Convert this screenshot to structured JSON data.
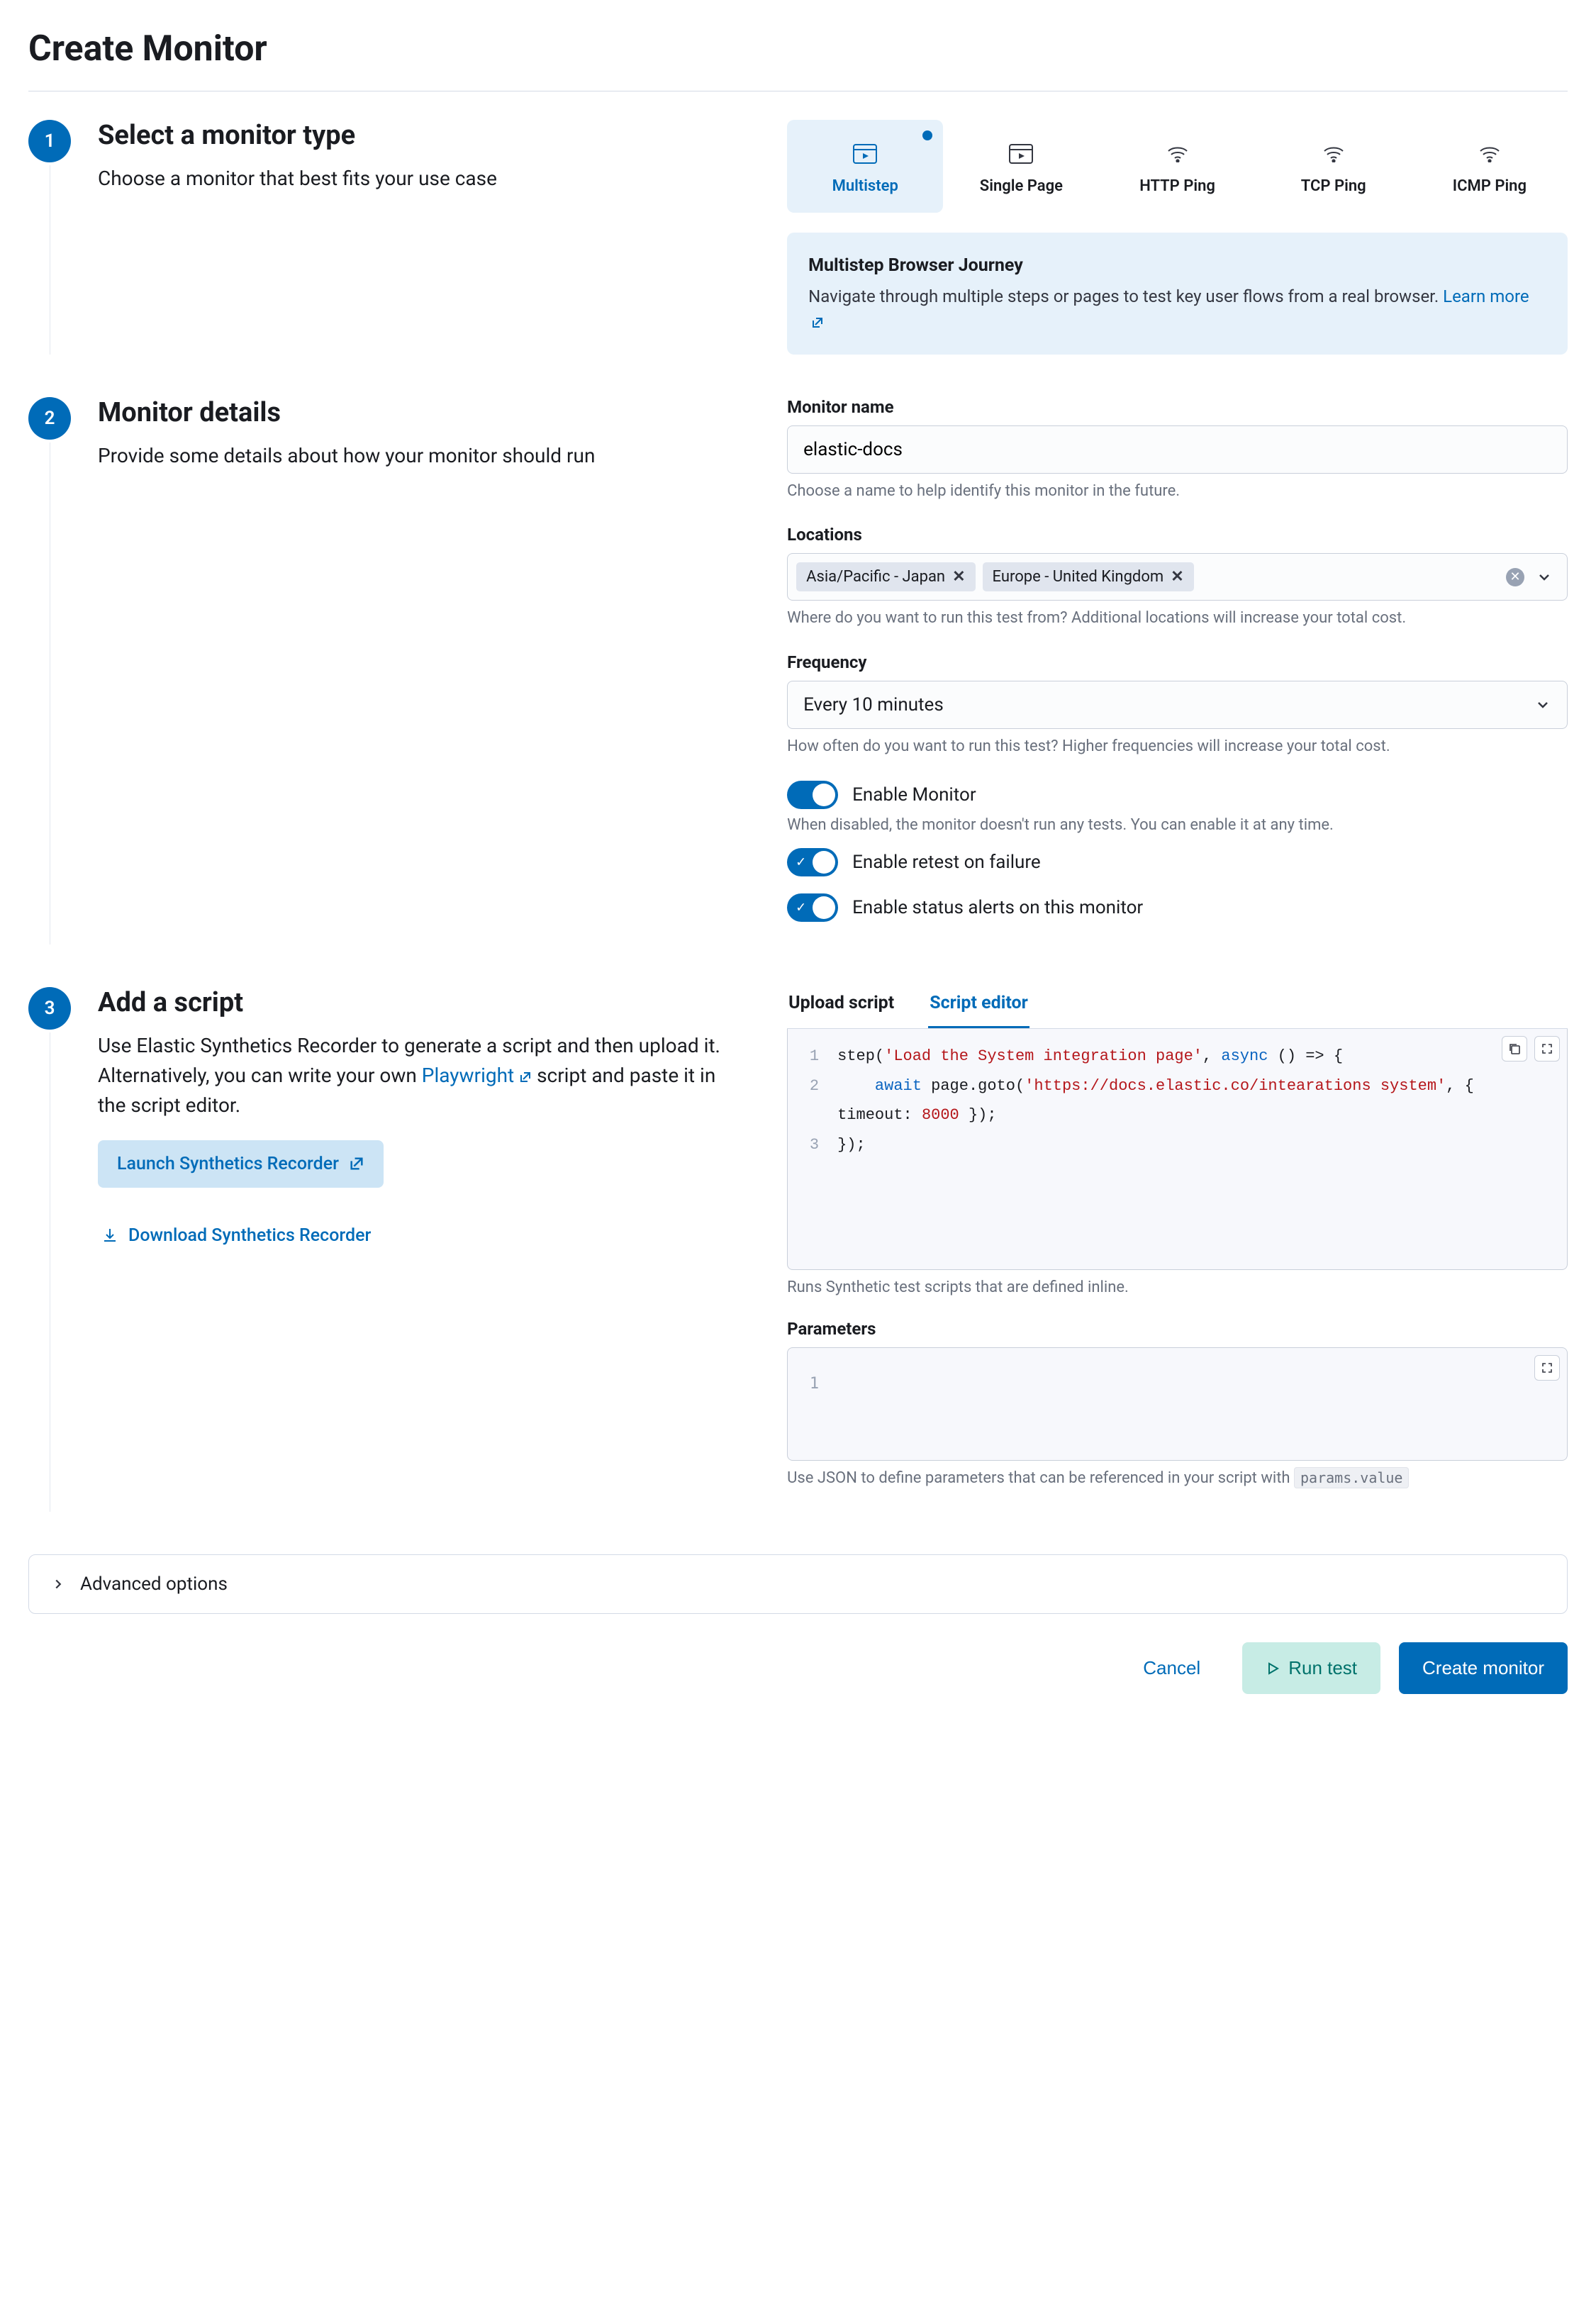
{
  "page": {
    "title": "Create Monitor"
  },
  "step1": {
    "title": "Select a monitor type",
    "desc": "Choose a monitor that best fits your use case",
    "types": [
      {
        "label": "Multistep",
        "selected": true
      },
      {
        "label": "Single Page"
      },
      {
        "label": "HTTP Ping"
      },
      {
        "label": "TCP Ping"
      },
      {
        "label": "ICMP Ping"
      }
    ],
    "callout": {
      "title": "Multistep Browser Journey",
      "body": "Navigate through multiple steps or pages to test key user flows from a real browser.",
      "link": "Learn more"
    }
  },
  "step2": {
    "title": "Monitor details",
    "desc": "Provide some details about how your monitor should run",
    "name": {
      "label": "Monitor name",
      "value": "elastic-docs",
      "help": "Choose a name to help identify this monitor in the future."
    },
    "locations": {
      "label": "Locations",
      "values": [
        "Asia/Pacific - Japan",
        "Europe - United Kingdom"
      ],
      "help": "Where do you want to run this test from? Additional locations will increase your total cost."
    },
    "frequency": {
      "label": "Frequency",
      "value": "Every 10 minutes",
      "help": "How often do you want to run this test? Higher frequencies will increase your total cost."
    },
    "toggles": {
      "enable": {
        "label": "Enable Monitor",
        "help": "When disabled, the monitor doesn't run any tests. You can enable it at any time."
      },
      "retest": {
        "label": "Enable retest on failure"
      },
      "alerts": {
        "label": "Enable status alerts on this monitor"
      }
    }
  },
  "step3": {
    "title": "Add a script",
    "desc_a": "Use Elastic Synthetics Recorder to generate a script and then upload it. Alternatively, you can write your own ",
    "desc_link": "Playwright",
    "desc_b": " script and paste it in the script editor.",
    "launch_btn": "Launch Synthetics Recorder",
    "download_link": "Download Synthetics Recorder",
    "tabs": {
      "upload": "Upload script",
      "editor": "Script editor"
    },
    "code": {
      "line1_a": "step(",
      "line1_str": "'Load the System integration page'",
      "line1_b": ", ",
      "line1_kw": "async",
      "line1_c": " () => {",
      "line2_a": "    ",
      "line2_kw": "await",
      "line2_b": " page.goto(",
      "line2_str": "'https://docs.elastic.co/intearations system'",
      "line2_c": ", { timeout: ",
      "line2_num": "8000",
      "line2_d": " });",
      "line3": "});",
      "help": "Runs Synthetic test scripts that are defined inline."
    },
    "params": {
      "label": "Parameters",
      "help_a": "Use JSON to define parameters that can be referenced in your script with ",
      "help_code": "params.value"
    }
  },
  "accordion": {
    "label": "Advanced options"
  },
  "footer": {
    "cancel": "Cancel",
    "run": "Run test",
    "create": "Create monitor"
  }
}
